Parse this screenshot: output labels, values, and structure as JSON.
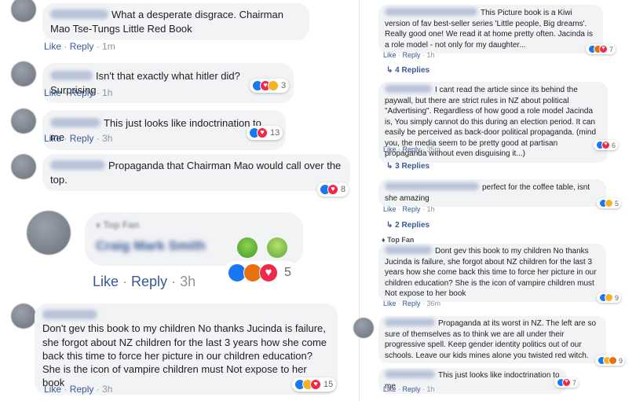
{
  "left": {
    "comments": [
      {
        "text": "What a desperate disgrace. Chairman Mao Tse-Tungs Little Red Book",
        "like": "Like",
        "reply": "Reply",
        "time": "1m"
      },
      {
        "text": "Isn't that exactly what hitler did? Surprising",
        "like": "Like",
        "reply": "Reply",
        "time": "1h",
        "count": "3"
      },
      {
        "text": "This just looks like indoctrination to me",
        "like": "Like",
        "reply": "Reply",
        "time": "3h",
        "count": "13"
      },
      {
        "text": "Propaganda that Chairman Mao would call over the top.",
        "count": "8"
      },
      {
        "badge": "Top Fan",
        "name": "Craig Mark Smith",
        "like": "Like",
        "reply": "Reply",
        "time": "3h",
        "count": "5"
      },
      {
        "text": "Don't gev this book to my children No thanks Jucinda is failure, she forgot about NZ children for the last 3 years how she come back this time to force her picture in our children education? She is the icon of vampire children must Not expose to her book",
        "like": "Like",
        "reply": "Reply",
        "time": "3h",
        "count": "15"
      }
    ]
  },
  "right": {
    "comments": [
      {
        "text": "This Picture book is a Kiwi version of fav best-seller series 'Little people, Big dreams'. Really good one! We read it at home pretty often. Jacinda is a role model - not only for my daughter...",
        "like": "Like",
        "reply": "Reply",
        "time": "1h",
        "count": "7",
        "replies": "4 Replies"
      },
      {
        "text": "I cant read the article since its behind the paywall, but there are strict rules in NZ about political \"Advertising\". Regardless of how good a role model Jacinda is, You simply cannot do this during an election period. It can easily be perceived as back-door political propaganda. (mind you, the media seem to be pretty good at partisan propaganda without even disguising it...)",
        "like": "Like",
        "reply": "Reply",
        "time": "35m",
        "count": "6",
        "replies": "3 Replies"
      },
      {
        "text": "perfect for the coffee table, isnt she amazing",
        "like": "Like",
        "reply": "Reply",
        "time": "1h",
        "count": "5",
        "replies": "2 Replies"
      },
      {
        "badge": "Top Fan",
        "text": "Dont gev this book to my children No thanks Jucinda is failure, she forgot about NZ children for the last 3 years how she come back this time to force her picture in our children education? She is the icon of vampire children must Not expose to her book",
        "like": "Like",
        "reply": "Reply",
        "time": "36m",
        "count": "9"
      },
      {
        "text": "Propaganda at its worst in NZ. The left are so sure of themselves as to think we are all under their progressive spell. Keep gender identity politics out of our schools. Leave our kids mines alone you twisted red witch.",
        "count": "9"
      },
      {
        "text": "This just looks like indoctrination to me",
        "like": "Like",
        "reply": "Reply",
        "time": "1h",
        "count": "7"
      }
    ]
  },
  "colors": {
    "link": "#385898",
    "bubble": "#f2f3f5",
    "like": "#1877f2",
    "love": "#f02849",
    "haha": "#f7b125",
    "angry": "#e9710f"
  }
}
